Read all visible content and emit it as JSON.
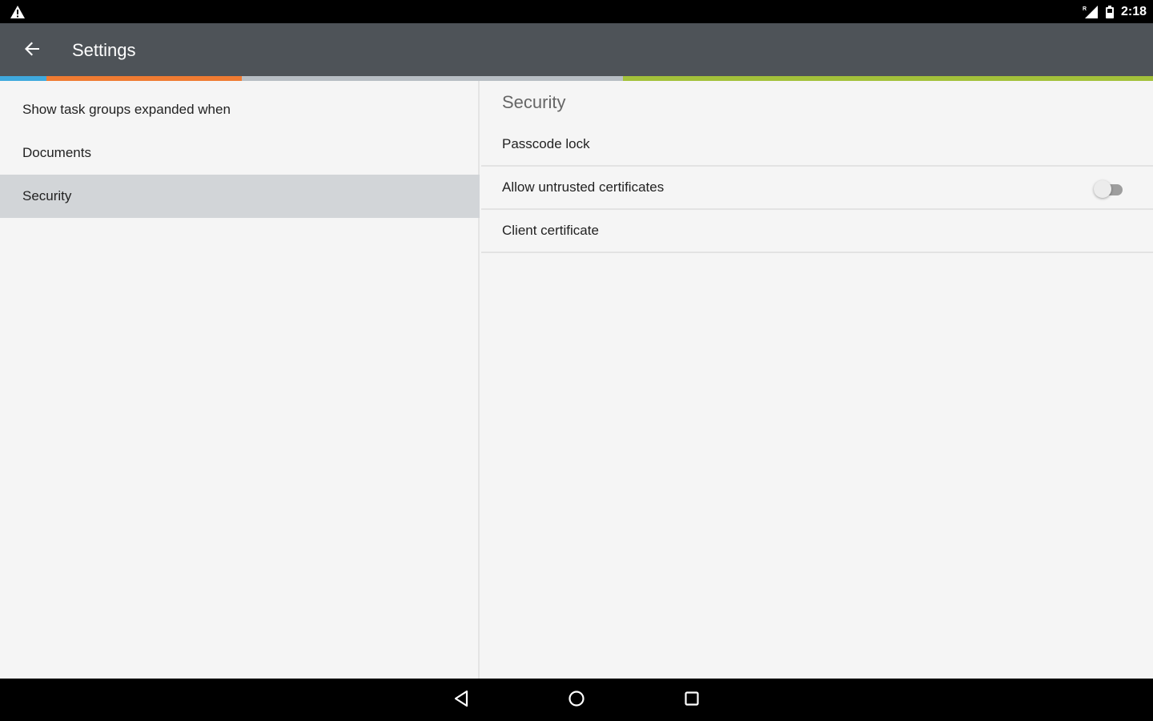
{
  "status_bar": {
    "time": "2:18",
    "icons": [
      "warning-icon",
      "signal-icon",
      "battery-icon"
    ]
  },
  "app_bar": {
    "title": "Settings",
    "back_icon": "arrow-left-icon",
    "background": "#4e5358"
  },
  "color_strip": {
    "colors": [
      "#3fa9dd",
      "#f07b32",
      "#b8bec4",
      "#a3c13a"
    ]
  },
  "left_pane": {
    "items": [
      {
        "label": "Show task groups expanded when",
        "selected": false
      },
      {
        "label": "Documents",
        "selected": false
      },
      {
        "label": "Security",
        "selected": true
      }
    ]
  },
  "right_pane": {
    "section_title": "Security",
    "items": [
      {
        "label": "Passcode lock"
      },
      {
        "label": "Allow untrusted certificates",
        "toggle": false
      },
      {
        "label": "Client certificate"
      }
    ]
  },
  "nav_bar": {
    "buttons": [
      "back-icon",
      "home-icon",
      "recents-icon"
    ]
  }
}
